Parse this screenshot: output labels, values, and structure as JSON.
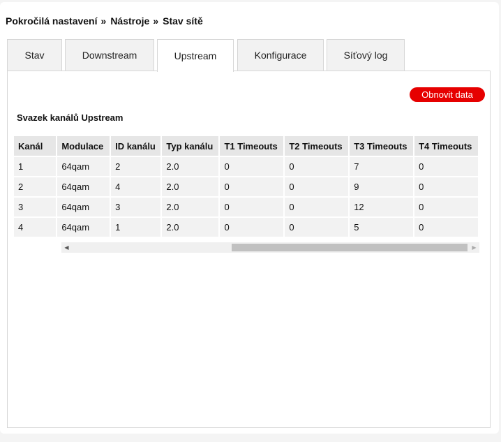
{
  "breadcrumb": {
    "item1": "Pokročilá nastavení",
    "item2": "Nástroje",
    "item3": "Stav sítě",
    "separator": "»"
  },
  "tabs": [
    {
      "label": "Stav",
      "active": false
    },
    {
      "label": "Downstream",
      "active": false
    },
    {
      "label": "Upstream",
      "active": true
    },
    {
      "label": "Konfigurace",
      "active": false
    },
    {
      "label": "Síťový log",
      "active": false
    }
  ],
  "refresh_label": "Obnovit data",
  "section_title": "Svazek kanálů Upstream",
  "table": {
    "headers": [
      "Kanál",
      "Modulace",
      "ID kanálu",
      "Typ kanálu",
      "T1 Timeouts",
      "T2 Timeouts",
      "T3 Timeouts",
      "T4 Timeouts"
    ],
    "rows": [
      [
        "1",
        "64qam",
        "2",
        "2.0",
        "0",
        "0",
        "7",
        "0"
      ],
      [
        "2",
        "64qam",
        "4",
        "2.0",
        "0",
        "0",
        "9",
        "0"
      ],
      [
        "3",
        "64qam",
        "3",
        "2.0",
        "0",
        "0",
        "12",
        "0"
      ],
      [
        "4",
        "64qam",
        "1",
        "2.0",
        "0",
        "0",
        "5",
        "0"
      ]
    ]
  },
  "icons": {
    "scroll_left": "chevron-left-icon",
    "scroll_right": "chevron-right-icon"
  },
  "colors": {
    "accent": "#e60000",
    "tab_bg": "#f2f2f2",
    "header_bg": "#e6e6e6"
  }
}
